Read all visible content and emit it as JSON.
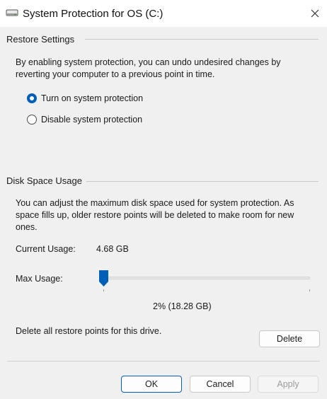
{
  "window": {
    "title": "System Protection for OS (C:)"
  },
  "restore_settings": {
    "title": "Restore Settings",
    "description": "By enabling system protection, you can undo undesired changes by reverting your computer to a previous point in time.",
    "options": [
      {
        "label": "Turn on system protection",
        "checked": true
      },
      {
        "label": "Disable system protection",
        "checked": false
      }
    ]
  },
  "disk_space": {
    "title": "Disk Space Usage",
    "description": "You can adjust the maximum disk space used for system protection. As space fills up, older restore points will be deleted to make room for new ones.",
    "current_usage_label": "Current Usage:",
    "current_usage_value": "4.68 GB",
    "max_usage_label": "Max Usage:",
    "max_usage_percent": 2,
    "max_usage_text": "2% (18.28 GB)",
    "delete_text": "Delete all restore points for this drive.",
    "delete_button": "Delete"
  },
  "footer": {
    "ok": "OK",
    "cancel": "Cancel",
    "apply": "Apply"
  },
  "colors": {
    "accent": "#005fb8",
    "background": "#f0f0f0",
    "titlebar": "#ffffff"
  }
}
